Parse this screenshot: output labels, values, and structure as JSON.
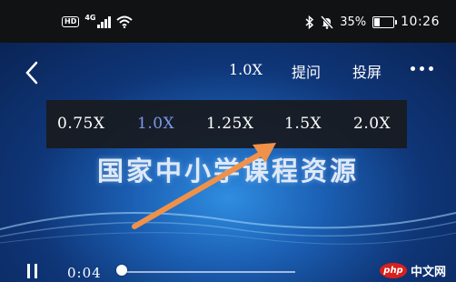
{
  "status_bar": {
    "hd_label": "HD",
    "network_label": "4G",
    "battery_percent": "35%",
    "battery_level": 0.35,
    "time": "10:26"
  },
  "player": {
    "current_speed": "1.0X",
    "ask_label": "提问",
    "cast_label": "投屏",
    "speed_options": [
      "0.75X",
      "1.0X",
      "1.25X",
      "1.5X",
      "2.0X"
    ],
    "selected_speed": "1.0X",
    "banner_title": "国家中小学课程资源",
    "elapsed_time": "0:04",
    "progress": 0.0
  },
  "watermark": {
    "logo_text": "php",
    "site_text": "中文网"
  },
  "colors": {
    "accent_selected": "#7e97ea",
    "annotation_arrow": "#f0914a",
    "menu_background": "#181a1e"
  }
}
